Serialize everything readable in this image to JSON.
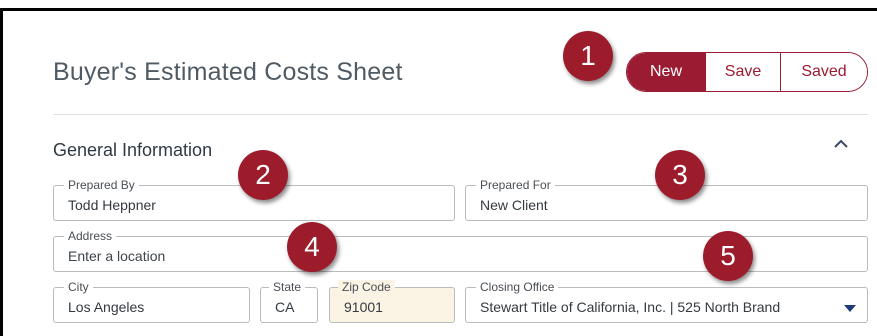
{
  "page": {
    "title": "Buyer's Estimated Costs Sheet"
  },
  "actions": {
    "new_label": "New",
    "save_label": "Save",
    "saved_label": "Saved"
  },
  "section": {
    "title": "General Information",
    "collapse_icon": "chevron-up-icon"
  },
  "fields": {
    "prepared_by": {
      "label": "Prepared By",
      "value": "Todd Heppner"
    },
    "prepared_for": {
      "label": "Prepared For",
      "value": "New Client"
    },
    "address": {
      "label": "Address",
      "placeholder": "Enter a location"
    },
    "city": {
      "label": "City",
      "value": "Los Angeles"
    },
    "state": {
      "label": "State",
      "value": "CA"
    },
    "zip": {
      "label": "Zip Code",
      "value": "91001"
    },
    "closing_office": {
      "label": "Closing Office",
      "value": "Stewart Title of California, Inc. | 525 North Brand"
    }
  },
  "callouts": [
    "1",
    "2",
    "3",
    "4",
    "5"
  ],
  "colors": {
    "accent": "#9b1b32",
    "callout": "#9c1c2c",
    "zip_bg": "#fbf3e4"
  }
}
